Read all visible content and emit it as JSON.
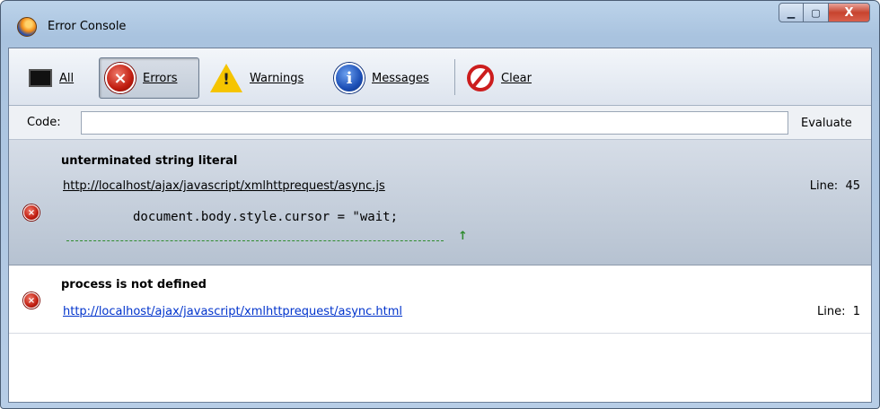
{
  "window": {
    "title": "Error Console",
    "controls": {
      "minimize": "▁",
      "maximize": "▢",
      "close": "X"
    }
  },
  "toolbar": {
    "all_label": "All",
    "errors_label": "Errors",
    "warnings_label": "Warnings",
    "messages_label": "Messages",
    "clear_label": "Clear",
    "active_filter": "Errors",
    "icons": {
      "errors": "×",
      "warnings": "!",
      "messages": "i"
    }
  },
  "codebar": {
    "label": "Code:",
    "input_value": "",
    "evaluate_label": "Evaluate"
  },
  "entries": [
    {
      "title": "unterminated string literal",
      "source": "http://localhost/ajax/javascript/xmlhttprequest/async.js",
      "line": "Line:  45",
      "code": "document.body.style.cursor = \"wait;",
      "caret": "↑",
      "selected": true
    },
    {
      "title": "process is not defined",
      "source": "http://localhost/ajax/javascript/xmlhttprequest/async.html",
      "line": "Line:  1",
      "selected": false
    }
  ],
  "colors": {
    "error_red": "#c01d10",
    "link_blue": "#0033cc",
    "caret_green": "#2e8b2e",
    "selection": "#b6c2d1"
  }
}
